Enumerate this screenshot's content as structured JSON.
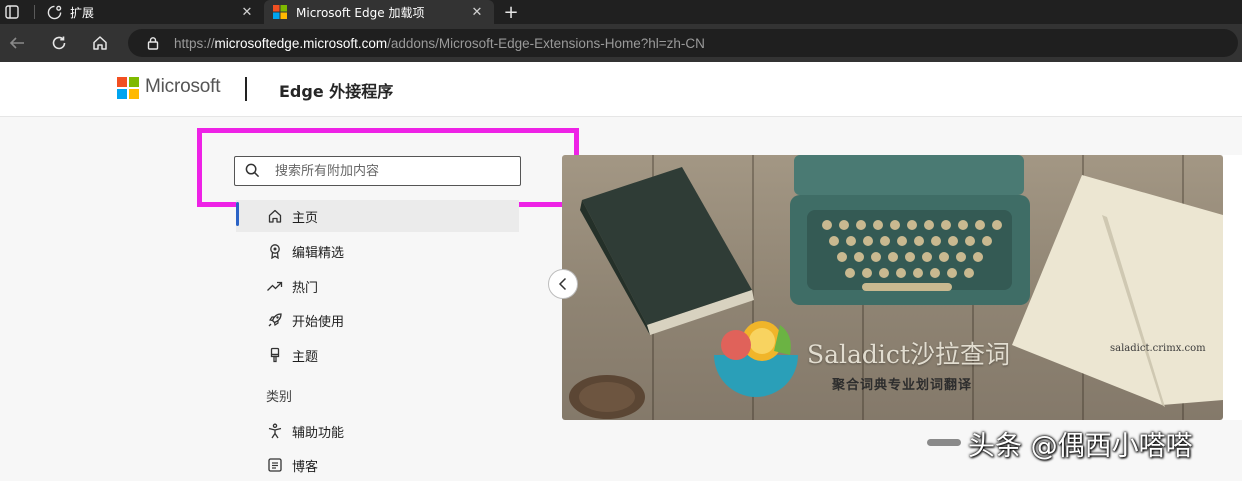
{
  "browser": {
    "tabs": [
      {
        "title": "扩展",
        "icon": "puzzle-icon",
        "active": false
      },
      {
        "title": "Microsoft Edge 加载项",
        "icon": "microsoft-logo-icon",
        "active": true
      }
    ],
    "url": {
      "scheme": "https://",
      "host": "microsoftedge.microsoft.com",
      "path": "/addons/Microsoft-Edge-Extensions-Home?hl=zh-CN"
    }
  },
  "header": {
    "brand": "Microsoft",
    "title": "Edge 外接程序"
  },
  "search": {
    "placeholder": "搜索所有附加内容",
    "value": ""
  },
  "nav": {
    "items": [
      {
        "label": "主页",
        "icon": "home-icon",
        "active": true
      },
      {
        "label": "编辑精选",
        "icon": "award-badge-icon",
        "active": false
      },
      {
        "label": "热门",
        "icon": "trending-icon",
        "active": false
      },
      {
        "label": "开始使用",
        "icon": "rocket-icon",
        "active": false
      },
      {
        "label": "主题",
        "icon": "paintbrush-icon",
        "active": false
      }
    ],
    "category_heading": "类别",
    "categories": [
      {
        "label": "辅助功能",
        "icon": "accessibility-icon"
      },
      {
        "label": "博客",
        "icon": "blog-icon"
      }
    ]
  },
  "hero": {
    "title": "Saladict沙拉查词",
    "tagline": "聚合词典专业划词翻译",
    "domain": "saladict.crimx.com"
  },
  "watermark": {
    "text": "头条 @偶西小嗒嗒"
  },
  "colors": {
    "highlight": "#ee22e6",
    "active_indicator": "#2b63c6",
    "ms_red": "#f25022",
    "ms_green": "#7fba00",
    "ms_blue": "#00a4ef",
    "ms_yellow": "#ffb900"
  }
}
